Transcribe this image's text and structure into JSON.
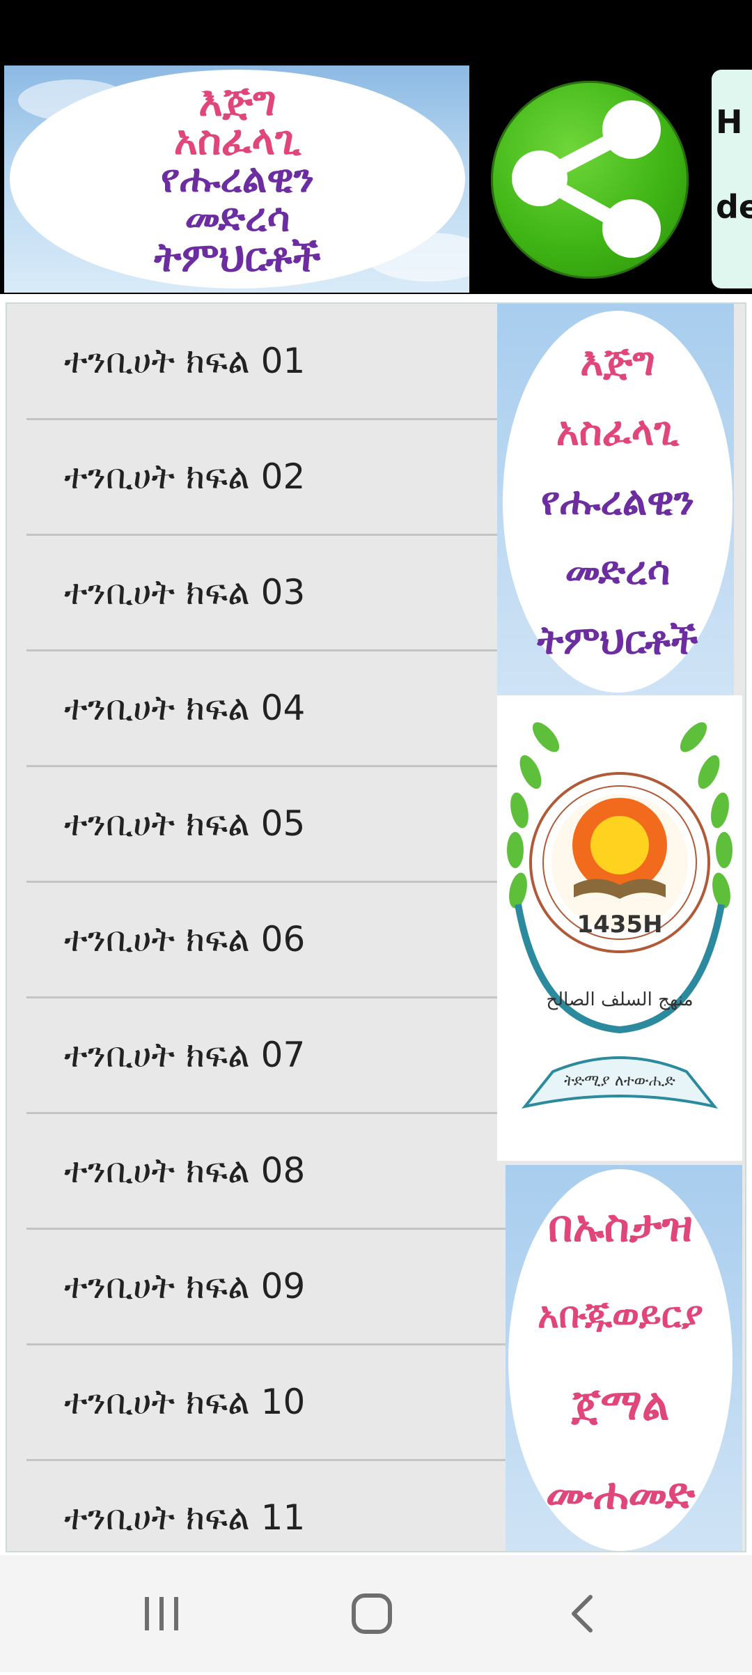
{
  "header": {
    "banner_lines": [
      {
        "text": "እጅግ",
        "color": "#e0467a"
      },
      {
        "text": "አስፈላጊ",
        "color": "#e0467a"
      },
      {
        "text": "የሑረልዊን",
        "color": "#6b2da0"
      },
      {
        "text": "መድረሳ",
        "color": "#6b2da0"
      },
      {
        "text": "ትምህርቶች",
        "color": "#6b2da0"
      }
    ],
    "share_icon": "share-icon",
    "side_card_lines": [
      "H",
      "de"
    ]
  },
  "lessons": [
    {
      "label": "ተንቢሀት ክፍል 01"
    },
    {
      "label": "ተንቢሀት ክፍል 02"
    },
    {
      "label": "ተንቢሀት ክፍል 03"
    },
    {
      "label": "ተንቢሀት ክፍል 04"
    },
    {
      "label": "ተንቢሀት ክፍል 05"
    },
    {
      "label": "ተንቢሀት ክፍል 06"
    },
    {
      "label": "ተንቢሀት ክፍል 07"
    },
    {
      "label": "ተንቢሀት ክፍል 08"
    },
    {
      "label": "ተንቢሀት ክፍል 09"
    },
    {
      "label": "ተንቢሀት ክፍል 10"
    },
    {
      "label": "ተንቢሀት ክፍል 11"
    }
  ],
  "side_images": {
    "image1_lines": [
      {
        "text": "እጅግ",
        "color": "#e0467a"
      },
      {
        "text": "አስፈላጊ",
        "color": "#e0467a"
      },
      {
        "text": "የሑረልዊን",
        "color": "#6b2da0"
      },
      {
        "text": "መድረሳ",
        "color": "#6b2da0"
      },
      {
        "text": "ትምህርቶች",
        "color": "#6b2da0"
      }
    ],
    "emblem_year": "1435H",
    "emblem_arabic": "منهج السلف الصالح",
    "emblem_ribbon": "ትድሚያ ለተውሒድ",
    "image3_lines": [
      "በኡስታዝ",
      "አቡጁወይርያ",
      "ጀማል",
      "ሙሐመድ"
    ]
  },
  "nav": {
    "recents_icon": "recents-icon",
    "home_icon": "home-icon",
    "back_icon": "back-icon"
  }
}
